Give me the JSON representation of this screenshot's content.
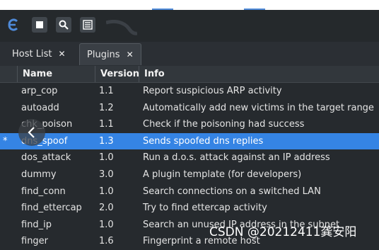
{
  "tabs": [
    {
      "label": "Host List",
      "close": "✕"
    },
    {
      "label": "Plugins",
      "close": "✕"
    }
  ],
  "columns": {
    "name": "Name",
    "version": "Version",
    "info": "Info"
  },
  "plugins": [
    {
      "mark": "",
      "name": "arp_cop",
      "version": "1.1",
      "info": "Report suspicious ARP activity"
    },
    {
      "mark": "",
      "name": "autoadd",
      "version": "1.2",
      "info": "Automatically add new victims in the target range"
    },
    {
      "mark": "",
      "name": "chk_poison",
      "version": "1.1",
      "info": "Check if the poisoning had success"
    },
    {
      "mark": "*",
      "name": "dns_spoof",
      "version": "1.3",
      "info": "Sends spoofed dns replies"
    },
    {
      "mark": "",
      "name": "dos_attack",
      "version": "1.0",
      "info": "Run a d.o.s. attack against an IP address"
    },
    {
      "mark": "",
      "name": "dummy",
      "version": "3.0",
      "info": "A plugin template (for developers)"
    },
    {
      "mark": "",
      "name": "find_conn",
      "version": "1.0",
      "info": "Search connections on a switched LAN"
    },
    {
      "mark": "",
      "name": "find_ettercap",
      "version": "2.0",
      "info": "Try to find ettercap activity"
    },
    {
      "mark": "",
      "name": "find_ip",
      "version": "1.0",
      "info": "Search an unused IP address in the subnet"
    },
    {
      "mark": "",
      "name": "finger",
      "version": "1.6",
      "info": "Fingerprint a remote host"
    }
  ],
  "selected_plugin": "dns_spoof",
  "watermark": "CSDN @20212411龚安阳",
  "icons": [
    "ettercap-logo-icon",
    "stop-icon",
    "search-icon",
    "plugin-list-icon",
    "chevron-left-icon"
  ],
  "colors": {
    "accent": "#3584e4",
    "background": "#262a2e",
    "logo": "#4f8ad8"
  }
}
